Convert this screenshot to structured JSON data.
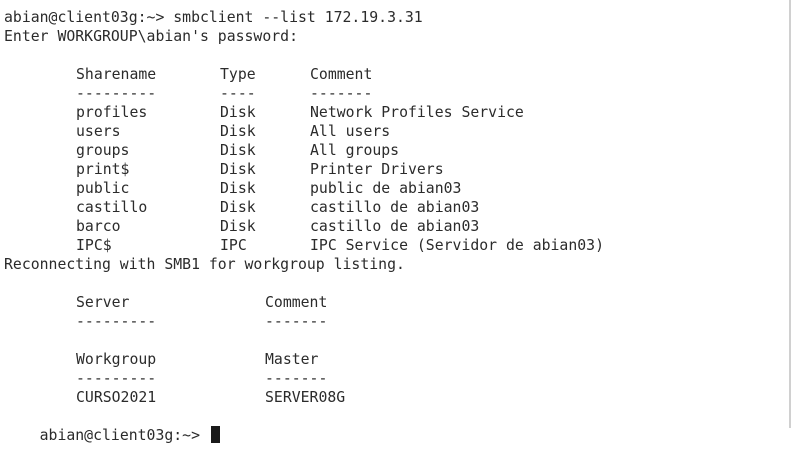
{
  "terminal": {
    "command_line": "abian@client03g:~> smbclient --list 172.19.3.31",
    "password_prompt": "Enter WORKGROUP\\abian's password:",
    "shares_header": {
      "name": "Sharename",
      "type": "Type",
      "comment": "Comment"
    },
    "shares_rule": {
      "name": "---------",
      "type": "----",
      "comment": "-------"
    },
    "shares": [
      {
        "name": "profiles",
        "type": "Disk",
        "comment": "Network Profiles Service"
      },
      {
        "name": "users",
        "type": "Disk",
        "comment": "All users"
      },
      {
        "name": "groups",
        "type": "Disk",
        "comment": "All groups"
      },
      {
        "name": "print$",
        "type": "Disk",
        "comment": "Printer Drivers"
      },
      {
        "name": "public",
        "type": "Disk",
        "comment": "public de abian03"
      },
      {
        "name": "castillo",
        "type": "Disk",
        "comment": "castillo de abian03"
      },
      {
        "name": "barco",
        "type": "Disk",
        "comment": "castillo de abian03"
      },
      {
        "name": "IPC$",
        "type": "IPC",
        "comment": "IPC Service (Servidor de abian03)"
      }
    ],
    "reconnect_message": "Reconnecting with SMB1 for workgroup listing.",
    "server_header": {
      "server": "Server",
      "comment": "Comment"
    },
    "server_rule": {
      "server": "---------",
      "comment": "-------"
    },
    "workgroup_header": {
      "workgroup": "Workgroup",
      "master": "Master"
    },
    "workgroup_rule": {
      "workgroup": "---------",
      "master": "-------"
    },
    "workgroups": [
      {
        "workgroup": "CURSO2021",
        "master": "SERVER08G"
      }
    ],
    "final_prompt": "abian@client03g:~> "
  }
}
